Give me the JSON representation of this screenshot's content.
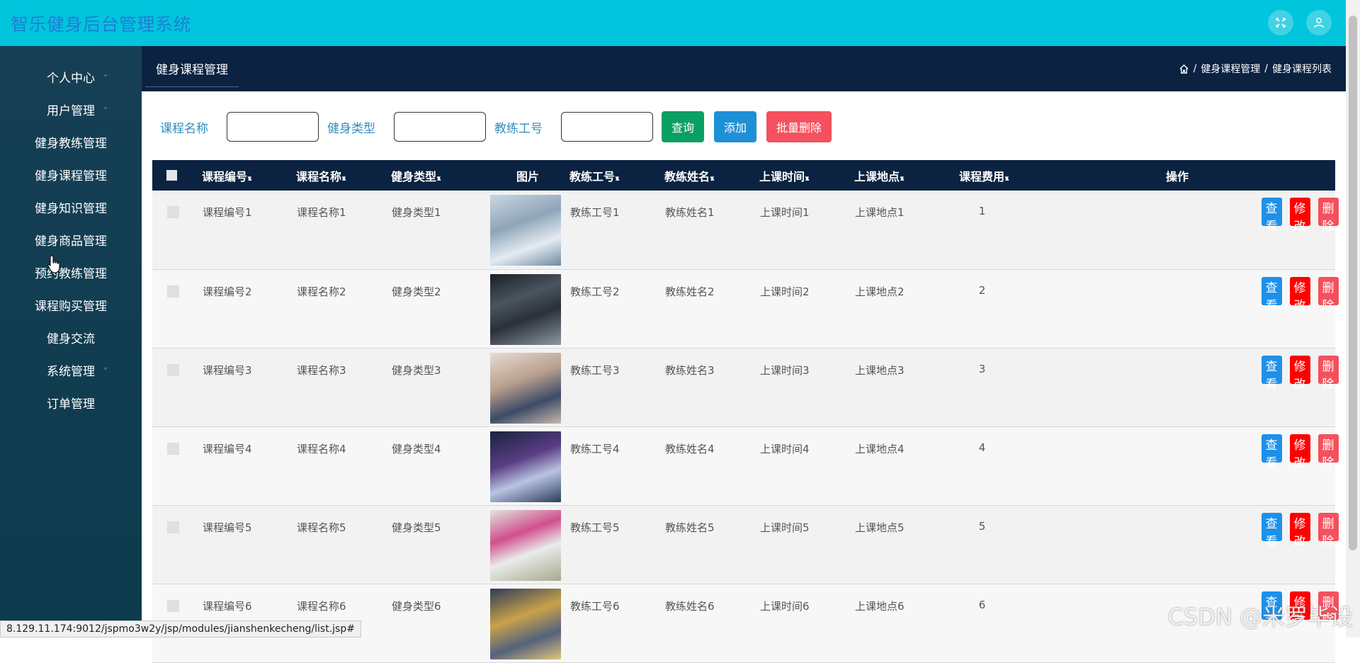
{
  "app": {
    "title": "智乐健身后台管理系统"
  },
  "sidebar": {
    "items": [
      {
        "label": "个人中心",
        "caret": true
      },
      {
        "label": "用户管理",
        "caret": true
      },
      {
        "label": "健身教练管理",
        "caret": true
      },
      {
        "label": "健身课程管理",
        "caret": true
      },
      {
        "label": "健身知识管理",
        "caret": true
      },
      {
        "label": "健身商品管理",
        "caret": true
      },
      {
        "label": "预约教练管理",
        "caret": true
      },
      {
        "label": "课程购买管理",
        "caret": true
      },
      {
        "label": "健身交流",
        "caret": false
      },
      {
        "label": "系统管理",
        "caret": true
      },
      {
        "label": "订单管理",
        "caret": false
      }
    ]
  },
  "header": {
    "tab": "健身课程管理",
    "breadcrumb": [
      "健身课程管理",
      "健身课程列表"
    ],
    "breadcrumb_sep": "/"
  },
  "search": {
    "label_name": "课程名称",
    "label_type": "健身类型",
    "label_coach": "教练工号",
    "query": "查询",
    "add": "添加",
    "batch_delete": "批量删除"
  },
  "table": {
    "columns": [
      "课程编号",
      "课程名称",
      "健身类型",
      "图片",
      "教练工号",
      "教练姓名",
      "上课时间",
      "上课地点",
      "课程费用",
      "操作"
    ],
    "sortable": [
      true,
      true,
      true,
      false,
      true,
      true,
      true,
      true,
      true,
      false
    ],
    "rows": [
      {
        "no": "课程编号1",
        "name": "课程名称1",
        "type": "健身类型1",
        "coach_no": "教练工号1",
        "coach": "教练姓名1",
        "time": "上课时间1",
        "place": "上课地点1",
        "fee": "1"
      },
      {
        "no": "课程编号2",
        "name": "课程名称2",
        "type": "健身类型2",
        "coach_no": "教练工号2",
        "coach": "教练姓名2",
        "time": "上课时间2",
        "place": "上课地点2",
        "fee": "2"
      },
      {
        "no": "课程编号3",
        "name": "课程名称3",
        "type": "健身类型3",
        "coach_no": "教练工号3",
        "coach": "教练姓名3",
        "time": "上课时间3",
        "place": "上课地点3",
        "fee": "3"
      },
      {
        "no": "课程编号4",
        "name": "课程名称4",
        "type": "健身类型4",
        "coach_no": "教练工号4",
        "coach": "教练姓名4",
        "time": "上课时间4",
        "place": "上课地点4",
        "fee": "4"
      },
      {
        "no": "课程编号5",
        "name": "课程名称5",
        "type": "健身类型5",
        "coach_no": "教练工号5",
        "coach": "教练姓名5",
        "time": "上课时间5",
        "place": "上课地点5",
        "fee": "5"
      },
      {
        "no": "课程编号6",
        "name": "课程名称6",
        "type": "健身类型6",
        "coach_no": "教练工号6",
        "coach": "教练姓名6",
        "time": "上课时间6",
        "place": "上课地点6",
        "fee": "6"
      }
    ],
    "actions": {
      "view": "查看",
      "edit": "修改",
      "delete": "删除"
    }
  },
  "icons": {
    "fullscreen": "fullscreen-icon",
    "user": "user-icon",
    "home": "home-icon",
    "sort": "sort-icon",
    "cursor": "hand-cursor-icon"
  },
  "colors": {
    "topbar": "#00c5dc",
    "title": "#1f7ed6",
    "sidebar": "#0d3b4d",
    "header": "#0b2241",
    "query": "#0aa064",
    "add": "#1e90d6",
    "danger": "#f5505d",
    "edit": "#ff0000"
  },
  "status_bar": "8.129.11.174:9012/jspmo3w2y/jsp/modules/jianshenkecheng/list.jsp#",
  "watermark": "CSDN @米罗毕设"
}
